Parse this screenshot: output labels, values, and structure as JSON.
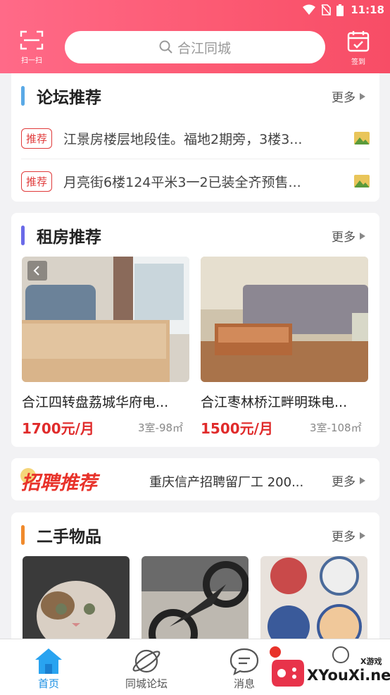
{
  "status_bar": {
    "time": "11:18"
  },
  "header": {
    "scan_label": "扫一扫",
    "search_placeholder": "合江同城",
    "checkin_label": "签到"
  },
  "forum": {
    "title": "论坛推荐",
    "more": "更多",
    "bar_color": "#5aa9e6",
    "items": [
      {
        "tag": "推荐",
        "text": "江景房楼层地段佳。福地2期旁，3楼3..."
      },
      {
        "tag": "推荐",
        "text": "月亮街6楼124平米3一2已装全齐预售..."
      }
    ]
  },
  "rental": {
    "title": "租房推荐",
    "more": "更多",
    "bar_color": "#6a6ae8",
    "items": [
      {
        "title": "合江四转盘荔城华府电...",
        "price": "1700元/月",
        "spec": "3室-98㎡"
      },
      {
        "title": "合江枣林桥江畔明珠电...",
        "price": "1500元/月",
        "spec": "3室-108㎡"
      }
    ]
  },
  "jobs": {
    "logo": "招聘推荐",
    "text": "重庆信产招聘留厂工 200...",
    "more": "更多"
  },
  "secondhand": {
    "title": "二手物品",
    "more": "更多",
    "bar_color": "#f08a2c"
  },
  "tabbar": {
    "items": [
      {
        "label": "首页",
        "icon": "home-icon",
        "active": true
      },
      {
        "label": "同城论坛",
        "icon": "planet-icon",
        "active": false
      },
      {
        "label": "消息",
        "icon": "message-icon",
        "active": false
      }
    ]
  },
  "watermark": {
    "brand": "XYouXi.net",
    "badge": "X游戏"
  },
  "colors": {
    "accent": "#fc5a73",
    "price": "#e02b2b",
    "active_tab": "#1a8fe3"
  }
}
